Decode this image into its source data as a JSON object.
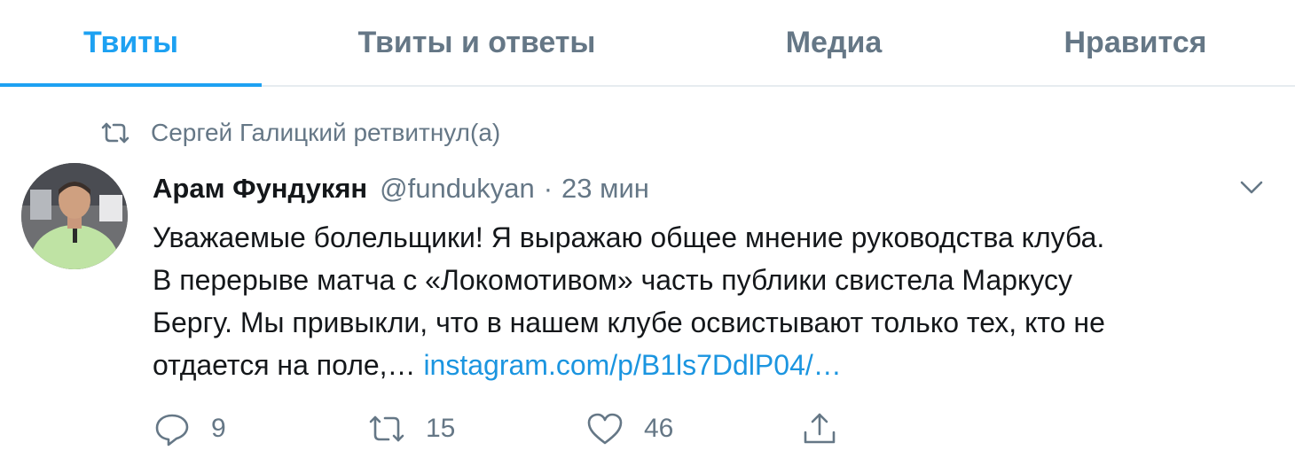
{
  "tabs": [
    {
      "label": "Твиты",
      "active": true
    },
    {
      "label": "Твиты и ответы",
      "active": false
    },
    {
      "label": "Медиа",
      "active": false
    },
    {
      "label": "Нравится",
      "active": false
    }
  ],
  "retweet_context": {
    "icon": "retweet-icon",
    "text": "Сергей Галицкий ретвитнул(а)"
  },
  "tweet": {
    "author_name": "Арам Фундукян",
    "author_handle": "@fundukyan",
    "separator": "·",
    "timestamp": "23 мин",
    "text_lines": [
      "Уважаемые болельщики! Я выражаю общее мнение руководства клуба.",
      "В перерыве матча с «Локомотивом» часть публики свистела Маркусу",
      "Бергу. Мы привыкли, что в нашем клубе освистывают только тех, кто не",
      "отдается на поле,…"
    ],
    "link_text": "instagram.com/p/B1ls7DdlP04/…",
    "actions": {
      "reply": {
        "icon": "reply-icon",
        "count": "9"
      },
      "retweet": {
        "icon": "retweet-icon",
        "count": "15"
      },
      "like": {
        "icon": "heart-icon",
        "count": "46"
      },
      "share": {
        "icon": "share-icon"
      }
    }
  },
  "colors": {
    "accent": "#1da1f2",
    "link": "#1b95e0",
    "secondary_text": "#657786",
    "primary_text": "#14171a",
    "divider": "#e6ecf0"
  }
}
